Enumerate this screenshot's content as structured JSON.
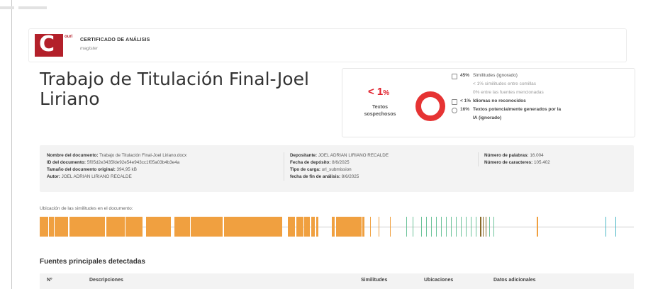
{
  "header": {
    "logo_letter": "C",
    "logo_vertical": "ouri",
    "certificate_title": "CERTIFICADO DE ANÁLISIS",
    "certificate_subtitle": "magister"
  },
  "document_title": "Trabajo de Titulación Final-Joel Liriano",
  "summary": {
    "percent": "< 1",
    "percent_unit": "%",
    "percent_label": "Textos sospechosos",
    "ring_color": "#e63333",
    "legend": [
      {
        "icon": "copy-icon",
        "value": "45%",
        "text": "Similitudes (ignorado)",
        "style": "normal"
      },
      {
        "icon": "",
        "value": "",
        "text": "< 1%  similitudes entre comillas",
        "style": "sub"
      },
      {
        "icon": "",
        "value": "",
        "text": "0%  entre las fuentes mencionadas",
        "style": "sub"
      },
      {
        "icon": "language-icon",
        "value": "< 1%",
        "text": "Idiomas no reconocidos",
        "style": "bold"
      },
      {
        "icon": "ai-icon",
        "value": "16%",
        "text": "Textos potencialmente generados por la",
        "style": "bold"
      },
      {
        "icon": "",
        "value": "",
        "text": "IA (ignorado)",
        "style": "bold"
      }
    ]
  },
  "metadata": {
    "col1": [
      {
        "k": "Nombre del documento:",
        "v": "Trabajo de Titulación Final-Joel Liriano.docx"
      },
      {
        "k": "ID del documento:",
        "v": "5f05d2e3435fde92e54e943cc1f05a03b4b3e4a"
      },
      {
        "k": "Tamaño del documento original:",
        "v": "394,95 kB"
      },
      {
        "k": "Autor:",
        "v": "JOEL ADRIAN LIRIANO RECALDE"
      }
    ],
    "col2": [
      {
        "k": "Depositante:",
        "v": "JOEL ADRIAN LIRIANO RECALDE"
      },
      {
        "k": "Fecha de depósito:",
        "v": "8/6/2025"
      },
      {
        "k": "Tipo de carga:",
        "v": "url_submission"
      },
      {
        "k": "fecha de fin de análisis:",
        "v": "8/6/2025"
      }
    ],
    "col3": [
      {
        "k": "Número de palabras:",
        "v": "16.004"
      },
      {
        "k": "Número de caracteres:",
        "v": "105.402"
      }
    ]
  },
  "location": {
    "label": "Ubicación de las similitudes en el documento:"
  },
  "sources": {
    "title": "Fuentes principales detectadas",
    "columns": [
      "Nº",
      "Descripciones",
      "Similitudes",
      "Ubicaciones",
      "Datos adicionales"
    ]
  },
  "colors": {
    "orange": "#f0a040",
    "green": "#6cc39a",
    "teal": "#4fb9c8",
    "brown": "#8a6a2a",
    "brand_red": "#b3202a"
  }
}
